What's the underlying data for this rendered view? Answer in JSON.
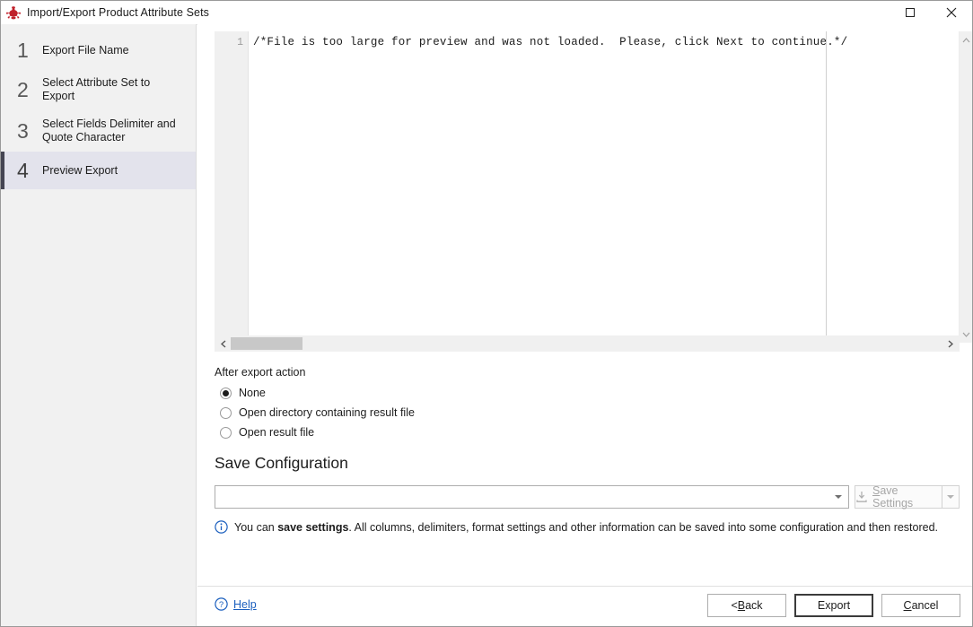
{
  "window": {
    "title": "Import/Export Product Attribute Sets",
    "icon": "app-icon",
    "controls": {
      "maximize": "maximize-icon",
      "close": "close-icon"
    }
  },
  "sidebar": {
    "steps": [
      {
        "number": "1",
        "label": "Export File Name",
        "active": false
      },
      {
        "number": "2",
        "label": "Select Attribute Set to Export",
        "active": false
      },
      {
        "number": "3",
        "label": "Select Fields Delimiter and Quote Character",
        "active": false
      },
      {
        "number": "4",
        "label": "Preview Export",
        "active": true
      }
    ]
  },
  "editor": {
    "line_number": "1",
    "content": "/*File is too large for preview and was not loaded.  Please, click Next to continue.*/",
    "vscroll": {
      "up": "▲",
      "down": "▼"
    },
    "hscroll": {
      "left": "❮",
      "right": "❯"
    }
  },
  "after_export": {
    "legend": "After export action",
    "options": [
      {
        "label": "None",
        "checked": true
      },
      {
        "label": "Open directory containing result file",
        "checked": false
      },
      {
        "label": "Open result file",
        "checked": false
      }
    ]
  },
  "save_configuration": {
    "heading": "Save Configuration",
    "combo_value": "",
    "combo_placeholder": "",
    "save_button": {
      "prefix": "",
      "accel": "S",
      "rest": "ave Settings",
      "icon": "save-download-icon",
      "disabled": true
    },
    "split_arrow": "dropdown-arrow-icon"
  },
  "info": {
    "icon": "info-circle-icon",
    "lead": "You can ",
    "bold": "save settings",
    "rest": ". All columns, delimiters, format settings and other information can be saved into some configuration and then restored."
  },
  "footer": {
    "help": {
      "icon": "help-circle-icon",
      "label": "Help"
    },
    "buttons": [
      {
        "name": "back",
        "prefix": "< ",
        "accel": "B",
        "rest": "ack",
        "default": false
      },
      {
        "name": "export",
        "prefix": "Export",
        "accel": "",
        "rest": "",
        "default": true
      },
      {
        "name": "cancel",
        "prefix": "",
        "accel": "C",
        "rest": "ancel",
        "default": false
      }
    ]
  },
  "colors": {
    "accent_link": "#1b5fbe",
    "active_step_bg": "#e3e3ec",
    "active_step_bar": "#454552",
    "sidebar_bg": "#f1f1f1",
    "app_icon_red": "#c0202a"
  }
}
